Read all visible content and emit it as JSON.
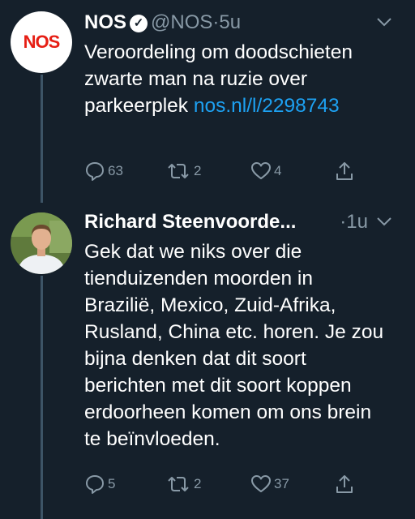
{
  "tweets": [
    {
      "display_name": "NOS",
      "handle": "@NOS",
      "separator": "·",
      "time": "5u",
      "avatar_text": "NOS",
      "text_plain": "Veroordeling om doodschieten zwarte man na ruzie over parkeerplek ",
      "link": "nos.nl/l/2298743",
      "replies": "63",
      "retweets": "2",
      "likes": "4"
    },
    {
      "display_name": "Richard Steenvoorde...",
      "separator": "·",
      "time": "1u",
      "text": "Gek dat we niks over die tienduizenden moorden in Brazilië, Mexico, Zuid-Afrika, Rusland, China etc. horen. Je zou bijna denken dat dit soort berichten met dit soort koppen erdoorheen komen om ons brein te beïnvloeden.",
      "replies": "5",
      "retweets": "2",
      "likes": "37"
    }
  ],
  "colors": {
    "background": "#15202b",
    "text": "#ffffff",
    "muted": "#8899a6",
    "link": "#1da1f2",
    "thread_line": "#3d5466"
  },
  "icons": [
    "verified-icon",
    "chevron-down-icon",
    "reply-icon",
    "retweet-icon",
    "like-icon",
    "share-icon"
  ]
}
